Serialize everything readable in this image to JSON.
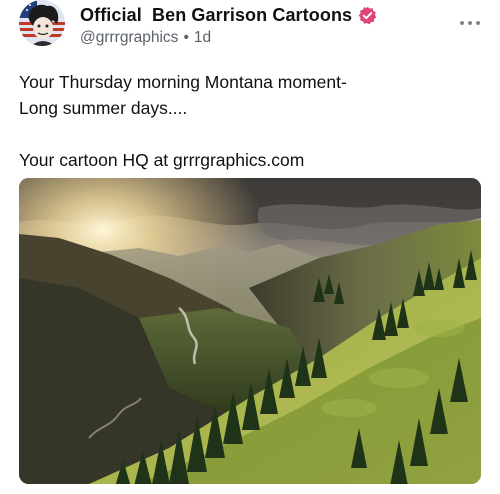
{
  "author": {
    "display_name": "Official  Ben Garrison Cartoons",
    "handle": "@grrrgraphics",
    "separator": "•",
    "timestamp": "1d",
    "verified_color": "#e0457b"
  },
  "post": {
    "lines": [
      "Your Thursday morning Montana moment-",
      "Long summer days....",
      "",
      "Your cartoon HQ at grrrgraphics.com"
    ]
  },
  "icons": {
    "avatar": "avatar-illustration",
    "verified": "verified-badge-icon",
    "more": "more-options-icon"
  }
}
